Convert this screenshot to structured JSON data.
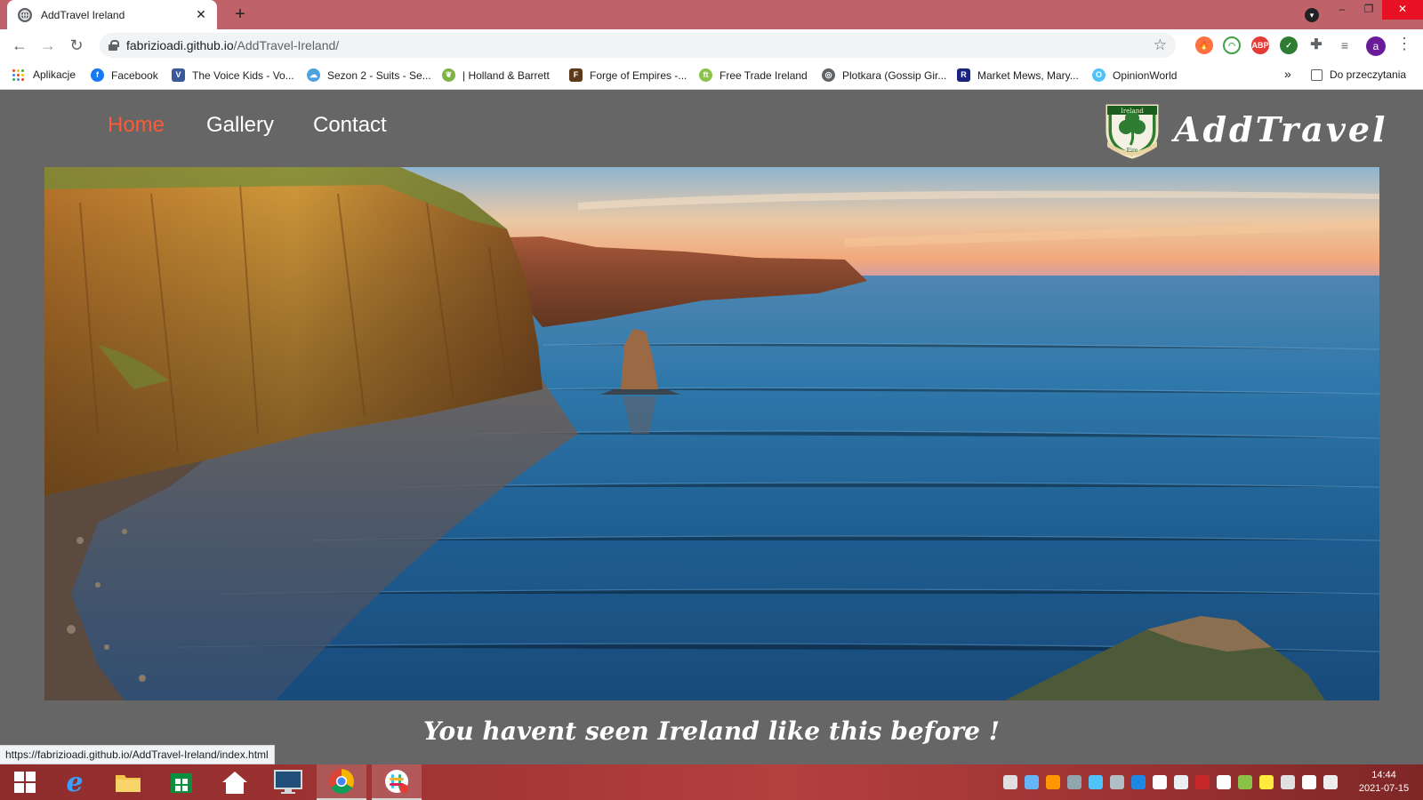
{
  "browser": {
    "tab_title": "AddTravel Ireland",
    "tab_close": "✕",
    "new_tab": "+",
    "url_host": "fabrizioadi.github.io",
    "url_path": "/AddTravel-Ireland/",
    "profile_initial": "a",
    "window_controls": {
      "minimize": "–",
      "restore": "❐",
      "close": "✕"
    },
    "bookmarks": [
      {
        "label": "Aplikacje",
        "icon": "apps-icon"
      },
      {
        "label": "Facebook",
        "icon": "facebook-icon",
        "color": "#1877f2"
      },
      {
        "label": "The Voice Kids - Vo...",
        "icon": "voice-kids-icon",
        "color": "#3b5998"
      },
      {
        "label": "Sezon 2 - Suits - Se...",
        "icon": "cloud-icon",
        "color": "#4aa3df"
      },
      {
        "label": "| Holland & Barrett",
        "icon": "holland-barrett-icon",
        "color": "#7cb342"
      },
      {
        "label": "Forge of Empires -...",
        "icon": "forge-icon",
        "color": "#5d3a1a"
      },
      {
        "label": "Free Trade Ireland",
        "icon": "free-trade-icon",
        "color": "#8bc34a"
      },
      {
        "label": "Plotkara (Gossip Gir...",
        "icon": "globe-icon",
        "color": "#5f6368"
      },
      {
        "label": "Market Mews, Mary...",
        "icon": "market-icon",
        "color": "#1a237e"
      },
      {
        "label": "OpinionWorld",
        "icon": "opinionworld-icon",
        "color": "#4fc3f7"
      }
    ],
    "bookmarks_overflow": "»",
    "reading_list": "Do przeczytania",
    "status_url": "https://fabrizioadi.github.io/AddTravel-Ireland/index.html"
  },
  "site": {
    "nav": [
      {
        "label": "Home",
        "active": true
      },
      {
        "label": "Gallery",
        "active": false
      },
      {
        "label": "Contact",
        "active": false
      }
    ],
    "brand": "AddTravel",
    "crest_top": "Ireland",
    "crest_bottom": "Eire",
    "tagline": "You havent seen Ireland like this before !",
    "accent": "#ff5a36",
    "background": "#666666"
  },
  "taskbar": {
    "time": "14:44",
    "date": "2021-07-15"
  }
}
